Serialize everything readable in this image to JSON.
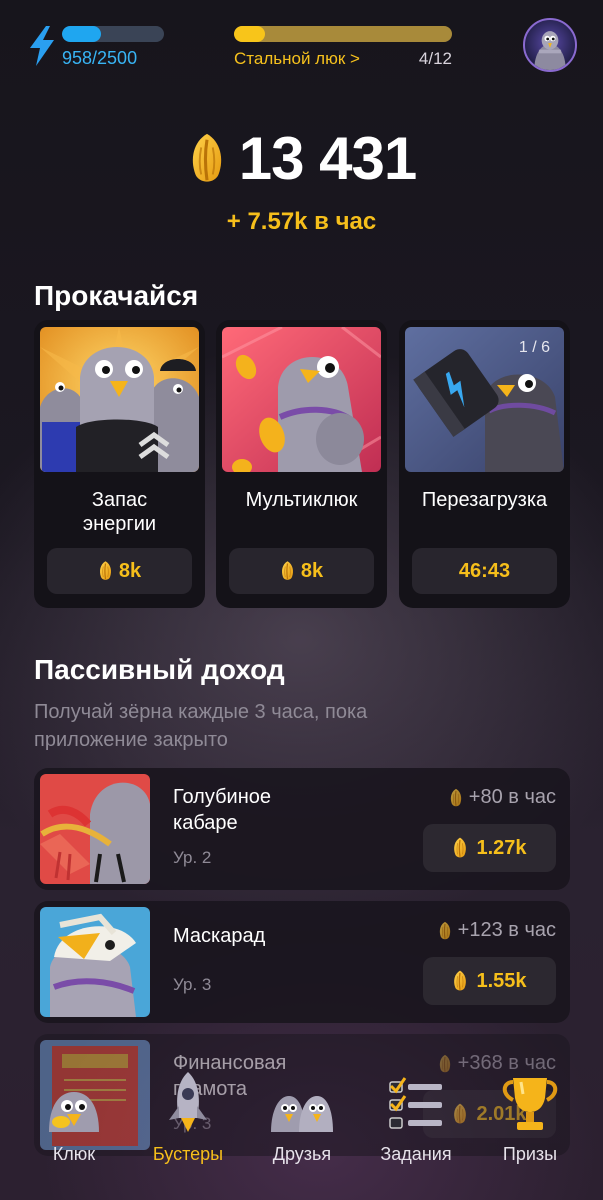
{
  "topbar": {
    "energy_text": "958/2500",
    "energy_fraction": 0.383,
    "level_name": "Стальной люк >",
    "level_count": "4/12",
    "level_fraction": 0.14,
    "icons": [
      "lightning-icon",
      "avatar"
    ]
  },
  "balance": {
    "value": "13 431",
    "rate": "+ 7.57k в час",
    "icon": "seed-icon"
  },
  "boosters_section": {
    "title": "Прокачайся",
    "items": [
      {
        "name": "Запас\nэнергии",
        "price": "8k",
        "counter": ""
      },
      {
        "name": "Мультиклюк",
        "price": "8k",
        "counter": ""
      },
      {
        "name": "Перезагрузка",
        "price": "46:43",
        "counter": "1 / 6"
      }
    ]
  },
  "passive_section": {
    "title": "Пассивный доход",
    "subtitle": "Получай зёрна каждые 3 часа, пока приложение закрыто",
    "items": [
      {
        "title": "Голубиное кабаре",
        "level": "Ур. 2",
        "per_hour": "+80 в час",
        "price": "1.27k"
      },
      {
        "title": "Маскарад",
        "level": "Ур. 3",
        "per_hour": "+123 в час",
        "price": "1.55k"
      },
      {
        "title": "Финансовая грамота",
        "level": "Ур. 3",
        "per_hour": "+368 в час",
        "price": "2.01k"
      }
    ]
  },
  "nav": {
    "items": [
      {
        "label": "Клюк",
        "active": false
      },
      {
        "label": "Бустеры",
        "active": true
      },
      {
        "label": "Друзья",
        "active": false
      },
      {
        "label": "Задания",
        "active": false
      },
      {
        "label": "Призы",
        "active": false
      }
    ]
  },
  "colors": {
    "accent_gold": "#f6bf1b",
    "energy_blue": "#1fa6f0",
    "card_bg": "#141218",
    "muted_text": "#8f8a96"
  }
}
